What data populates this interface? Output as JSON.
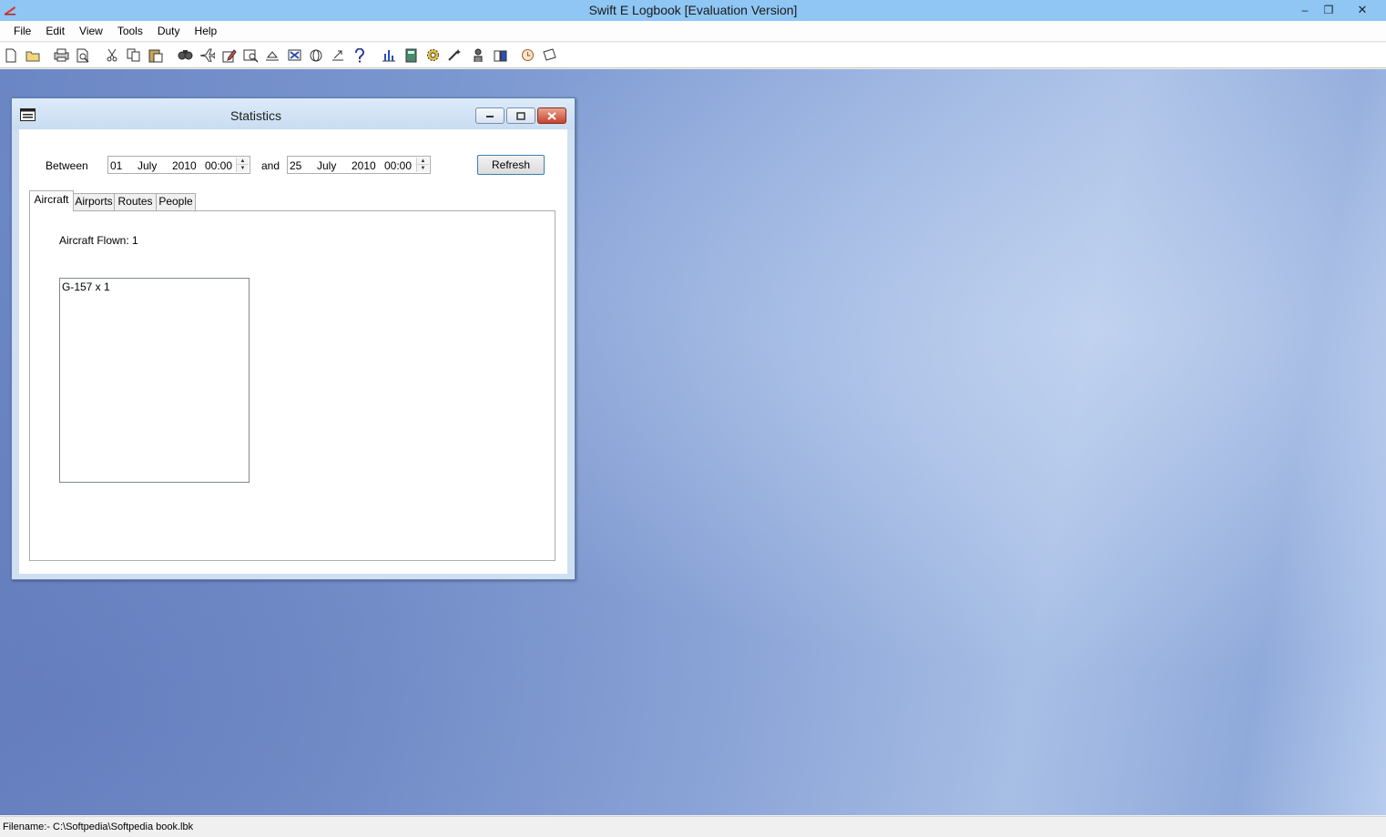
{
  "window": {
    "title": "Swift E Logbook [Evaluation Version]",
    "controls": {
      "minimize": "–",
      "restore": "❐",
      "close": "✕"
    }
  },
  "menu": [
    "File",
    "Edit",
    "View",
    "Tools",
    "Duty",
    "Help"
  ],
  "toolbar_icons": [
    "new-icon",
    "open-icon",
    "print-icon",
    "print-preview-icon",
    "cut-icon",
    "copy-icon",
    "paste-icon",
    "find-icon",
    "aircraft-icon",
    "edit-record-icon",
    "search-icon",
    "sort-icon",
    "filter-icon",
    "globe-icon",
    "export-icon",
    "help-icon",
    "bar-chart-icon",
    "calculator-icon",
    "settings-gear-icon",
    "wizard-icon",
    "pilot-icon",
    "duty-icon",
    "clock-icon",
    "notes-icon"
  ],
  "statistics": {
    "title": "Statistics",
    "between_label": "Between",
    "and_label": "and",
    "refresh_label": "Refresh",
    "from": {
      "day": "01",
      "month": "July",
      "year": "2010",
      "time": "00:00"
    },
    "to": {
      "day": "25",
      "month": "July",
      "year": "2010",
      "time": "00:00"
    },
    "tabs": [
      "Aircraft",
      "Airports",
      "Routes",
      "People"
    ],
    "active_tab": "Aircraft",
    "aircraft_flown_label": "Aircraft Flown: 1",
    "aircraft_list": [
      "G-157 x 1"
    ]
  },
  "statusbar": {
    "filename": "Filename:- C:\\Softpedia\\Softpedia book.lbk"
  },
  "colors": {
    "titlebar": "#8fc6f4",
    "desktop": "#7b97d0",
    "close_button": "#c4442b"
  }
}
